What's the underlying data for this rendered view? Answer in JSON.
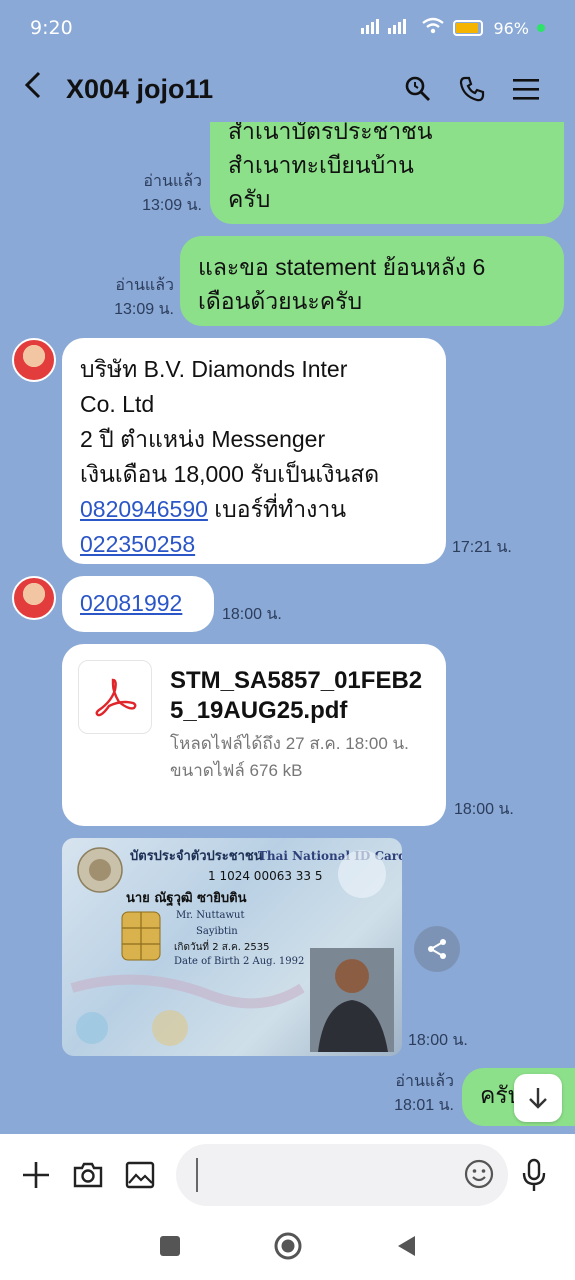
{
  "status": {
    "time": "9:20",
    "battery": "96%"
  },
  "header": {
    "title": "X004 jojo11"
  },
  "messages": {
    "m1": {
      "text_partial": "สำเนาบัตรประชาชน",
      "text_line2": "สำเนาทะเบียนบ้าน",
      "text_line3": "ครับ",
      "read": "อ่านแล้ว",
      "time": "13:09 น."
    },
    "m2": {
      "text_line1": "และขอ statement ย้อนหลัง 6",
      "text_line2": "เดือนด้วยนะครับ",
      "read": "อ่านแล้ว",
      "time": "13:09 น."
    },
    "m3": {
      "line1": "บริษัท B.V. Diamonds Inter",
      "line2": "Co. Ltd",
      "line3": "2 ปี ตำแหน่ง Messenger",
      "line4": "เงินเดือน 18,000  รับเป็นเงินสด",
      "phone1": "0820946590",
      "line5_rest": " เบอร์ที่ทำงาน",
      "phone2": "022350258",
      "time": "17:21 น."
    },
    "m4": {
      "phone": "02081992",
      "time": "18:00 น."
    },
    "m5": {
      "filename": "STM_SA5857_01FEB25_19AUG25.pdf",
      "download_until": "โหลดไฟล์ได้ถึง 27 ส.ค. 18:00 น.",
      "filesize": "ขนาดไฟล์ 676 kB",
      "time": "18:00 น."
    },
    "m6": {
      "card_title_th": "บัตรประจำตัวประชาชน",
      "card_title_en": "Thai National ID Card",
      "id_number": "1 1024 00063 33 5",
      "name_th": "นาย ณัฐวุฒิ ซายิบติน",
      "name_en": "Mr. Nuttawut",
      "lastname_en": "Sayibtin",
      "dob_th": "เกิดวันที่ 2 ส.ค. 2535",
      "dob_en": "Date of Birth 2 Aug. 1992",
      "time": "18:00 น."
    },
    "m7": {
      "text": "ครับ",
      "read": "อ่านแล้ว",
      "time": "18:01 น."
    }
  },
  "colors": {
    "chat_bg": "#8aa9d6",
    "outgoing": "#8de08a",
    "incoming": "#ffffff",
    "link": "#2b56c7"
  }
}
